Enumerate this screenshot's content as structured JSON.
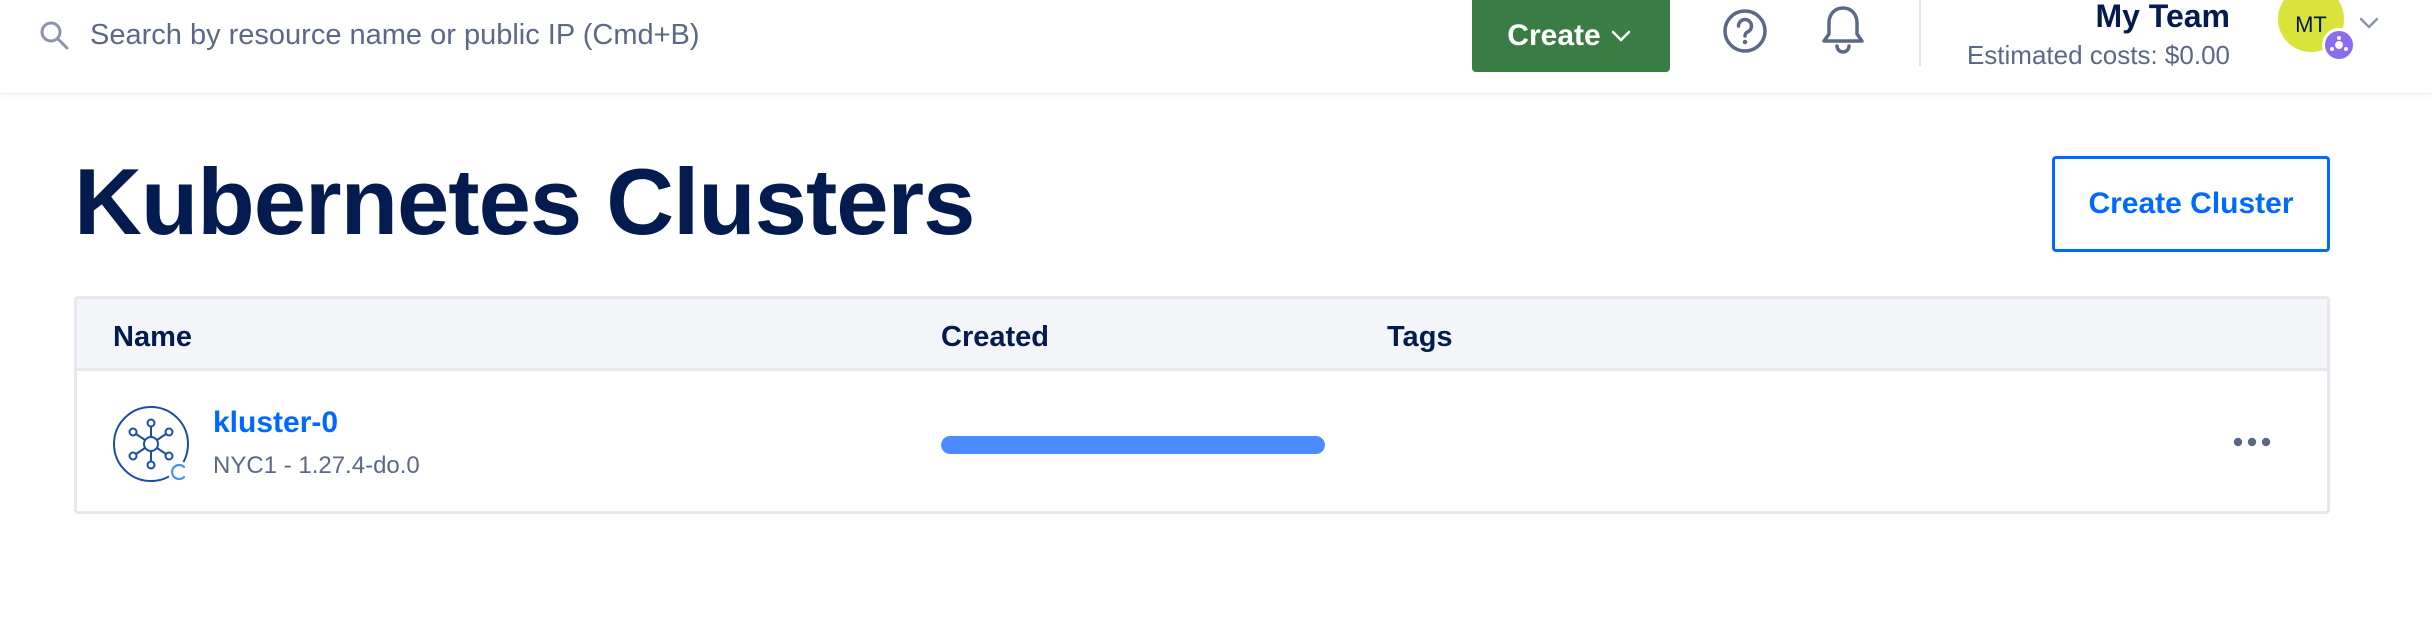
{
  "topbar": {
    "search": {
      "placeholder": "Search by resource name or public IP (Cmd+B)",
      "value": ""
    },
    "create_label": "Create",
    "team": {
      "name": "My Team",
      "estimated_costs": "Estimated costs: $0.00",
      "avatar_initials": "MT"
    },
    "icons": {
      "search": "search-icon",
      "help": "question-circle-icon",
      "notifications": "bell-icon",
      "create_dropdown": "chevron-down-icon",
      "account_dropdown": "chevron-down-icon"
    }
  },
  "page": {
    "title": "Kubernetes Clusters",
    "create_cluster_label": "Create Cluster"
  },
  "table": {
    "columns": [
      "Name",
      "Created",
      "Tags"
    ],
    "rows": [
      {
        "name": "kluster-0",
        "meta": "NYC1 - 1.27.4-do.0",
        "created_progress_fraction": 1.0,
        "tags": [],
        "icon": "kubernetes-cluster-icon",
        "actions_icon": "more-horizontal-icon"
      }
    ]
  },
  "colors": {
    "primary": "#0069ff",
    "create_button": "#3a7d44",
    "heading": "#031b4e",
    "muted_text": "#5b6987",
    "avatar_bg": "#d9e33a",
    "progress": "#4a8cff"
  }
}
